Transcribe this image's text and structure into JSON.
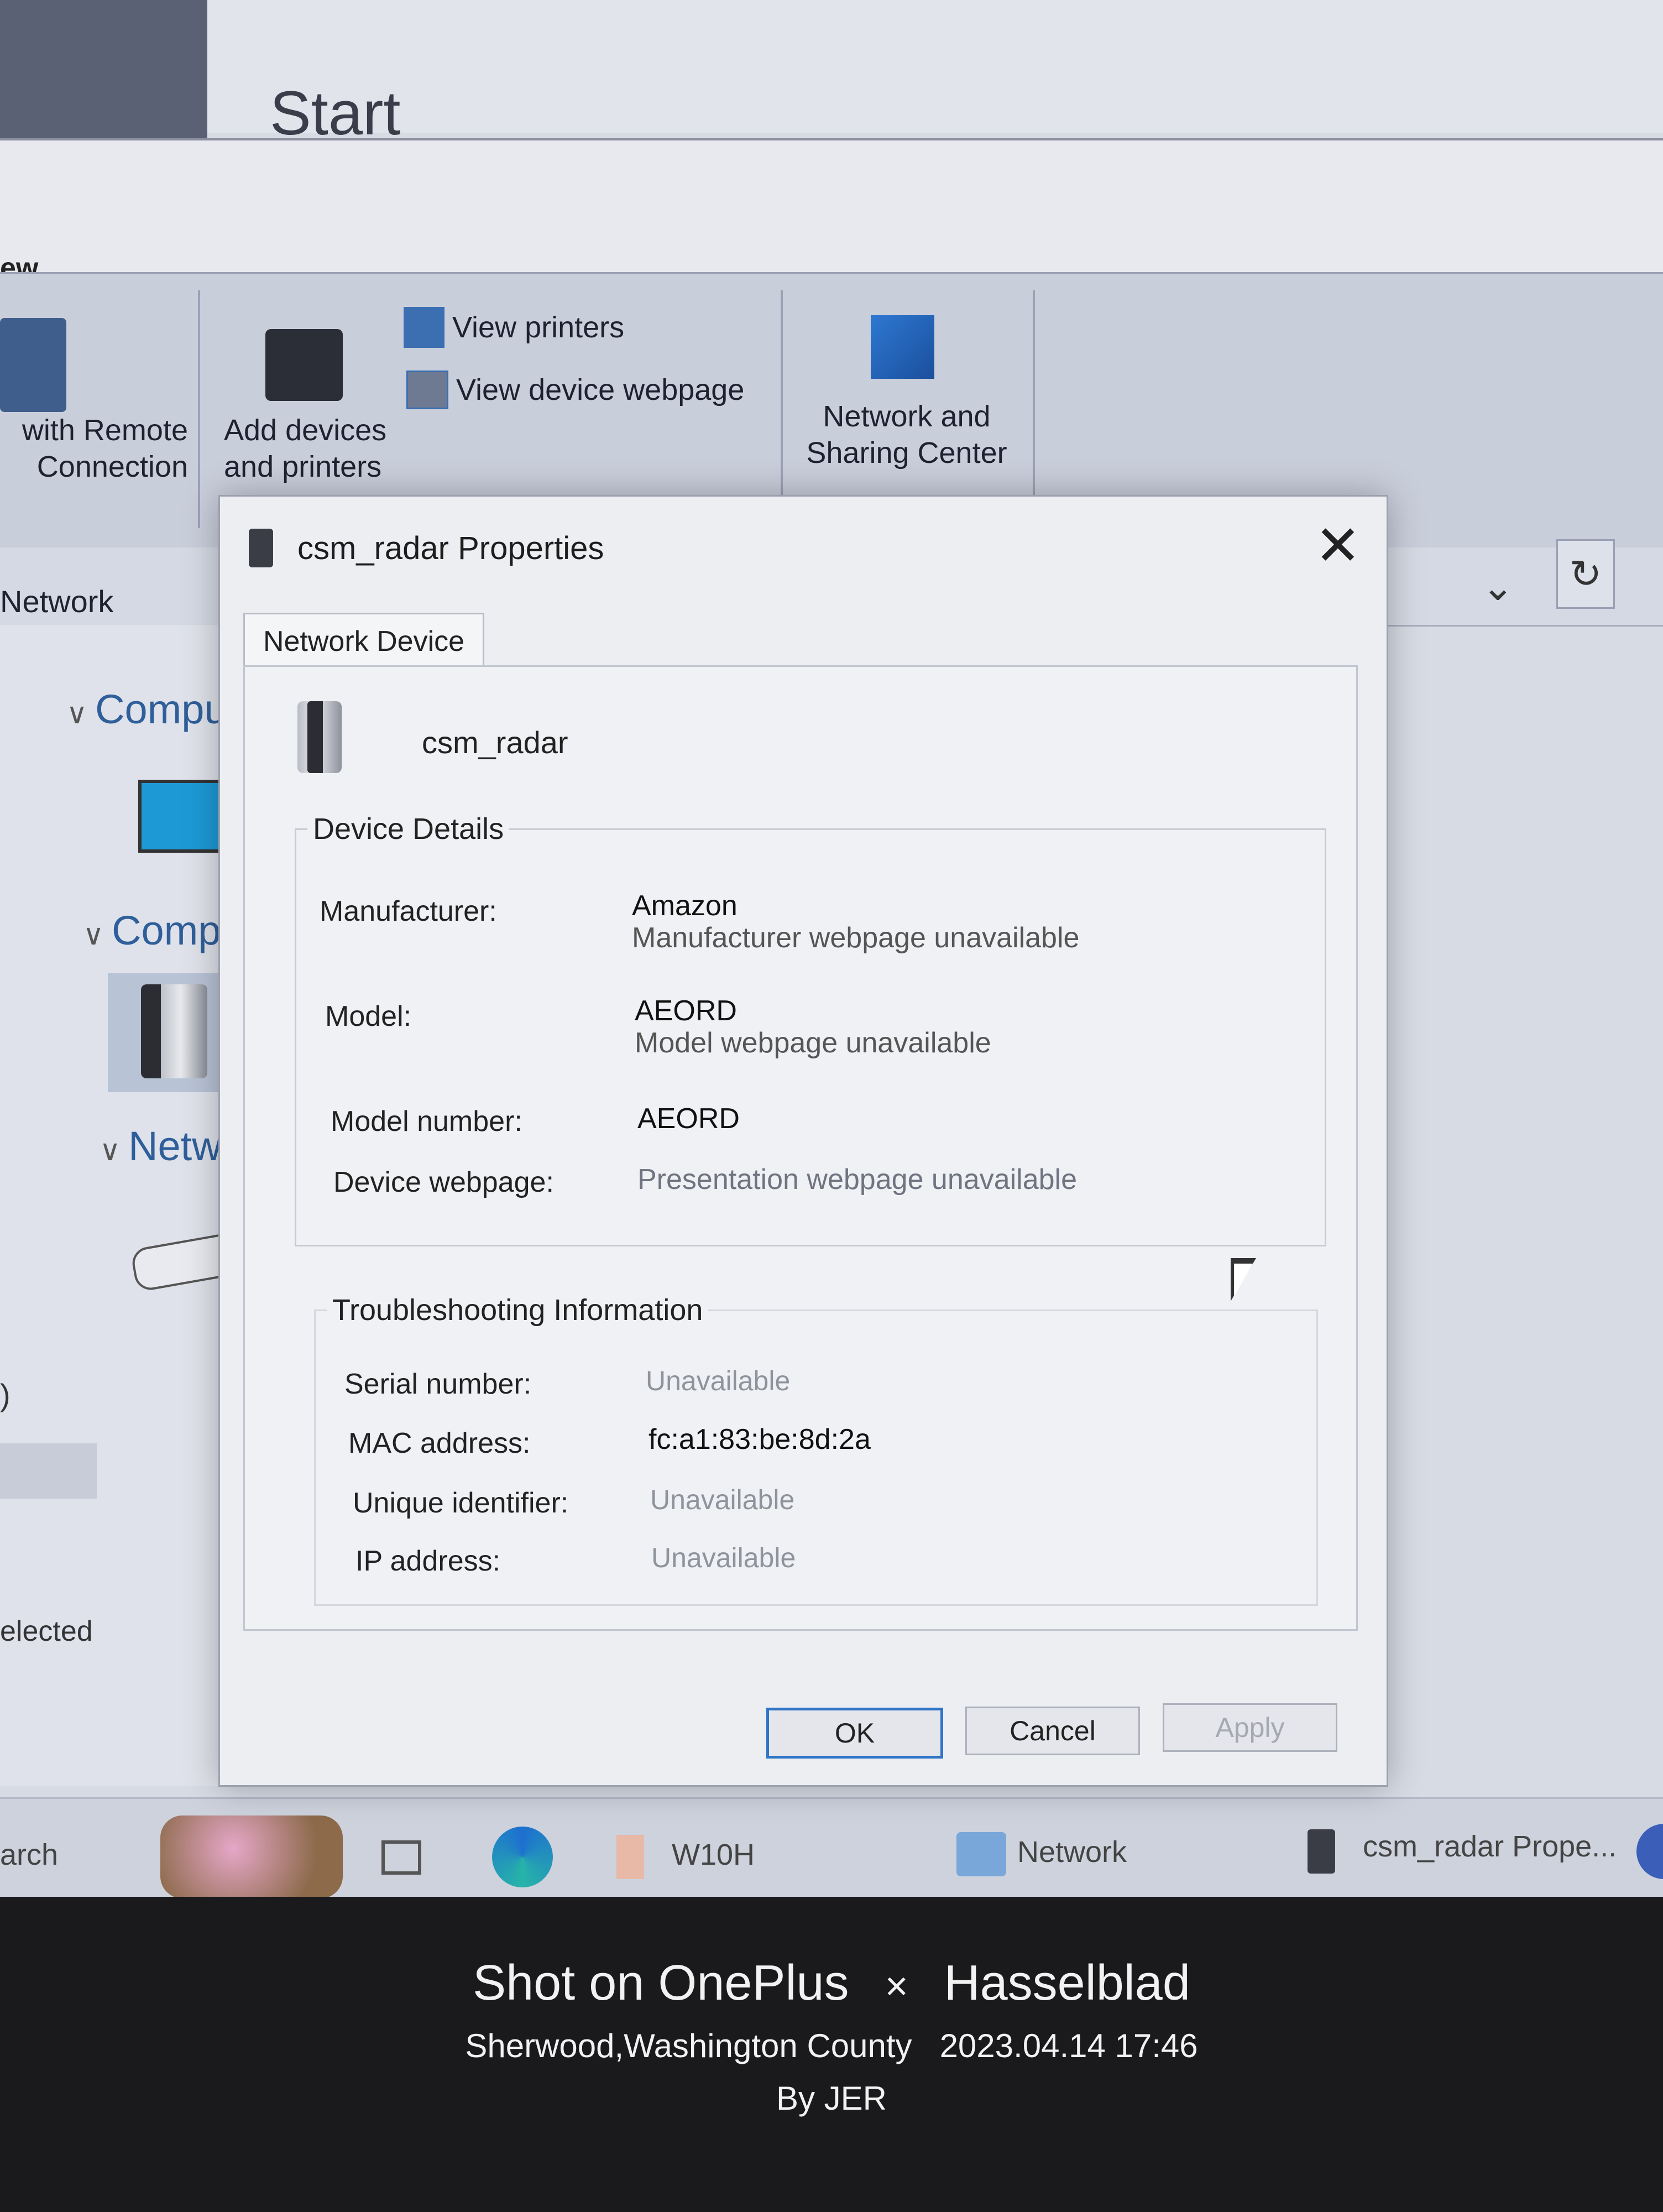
{
  "background_window": {
    "start_title": "Start",
    "ribbon_tab_fragment": "ew",
    "ribbon": {
      "remote_connection": [
        "with Remote",
        "Connection"
      ],
      "add_devices": [
        "Add devices",
        "and printers"
      ],
      "view_printers": "View printers",
      "view_device_webpage": "View device webpage",
      "network_sharing": [
        "Network and",
        "Sharing Center"
      ]
    },
    "address_bar": {
      "location": "Network"
    },
    "nav_groups": [
      "Compu",
      "Compu",
      "Netwo"
    ],
    "status_fragment": "elected",
    "paren_fragment": ")"
  },
  "taskbar": {
    "search_fragment": "arch",
    "items": [
      "W10H",
      "Network",
      "csm_radar Prope..."
    ]
  },
  "dialog": {
    "title": "csm_radar Properties",
    "tab_label": "Network Device",
    "device_name": "csm_radar",
    "device_details": {
      "legend": "Device Details",
      "manufacturer_label": "Manufacturer:",
      "manufacturer_value": "Amazon",
      "manufacturer_sub": "Manufacturer webpage unavailable",
      "model_label": "Model:",
      "model_value": "AEORD",
      "model_sub": "Model webpage unavailable",
      "model_number_label": "Model number:",
      "model_number_value": "AEORD",
      "device_webpage_label": "Device webpage:",
      "device_webpage_value": "Presentation webpage unavailable"
    },
    "troubleshooting": {
      "legend": "Troubleshooting Information",
      "serial_label": "Serial number:",
      "serial_value": "Unavailable",
      "mac_label": "MAC address:",
      "mac_value": "fc:a1:83:be:8d:2a",
      "uid_label": "Unique identifier:",
      "uid_value": "Unavailable",
      "ip_label": "IP address:",
      "ip_value": "Unavailable"
    },
    "buttons": {
      "ok": "OK",
      "cancel": "Cancel",
      "apply": "Apply"
    }
  },
  "photo_caption": {
    "line1_left": "Shot on OnePlus",
    "line1_sep": "×",
    "line1_right": "Hasselblad",
    "line2": "Sherwood,Washington County   2023.04.14 17:46",
    "line3": "By JER"
  }
}
